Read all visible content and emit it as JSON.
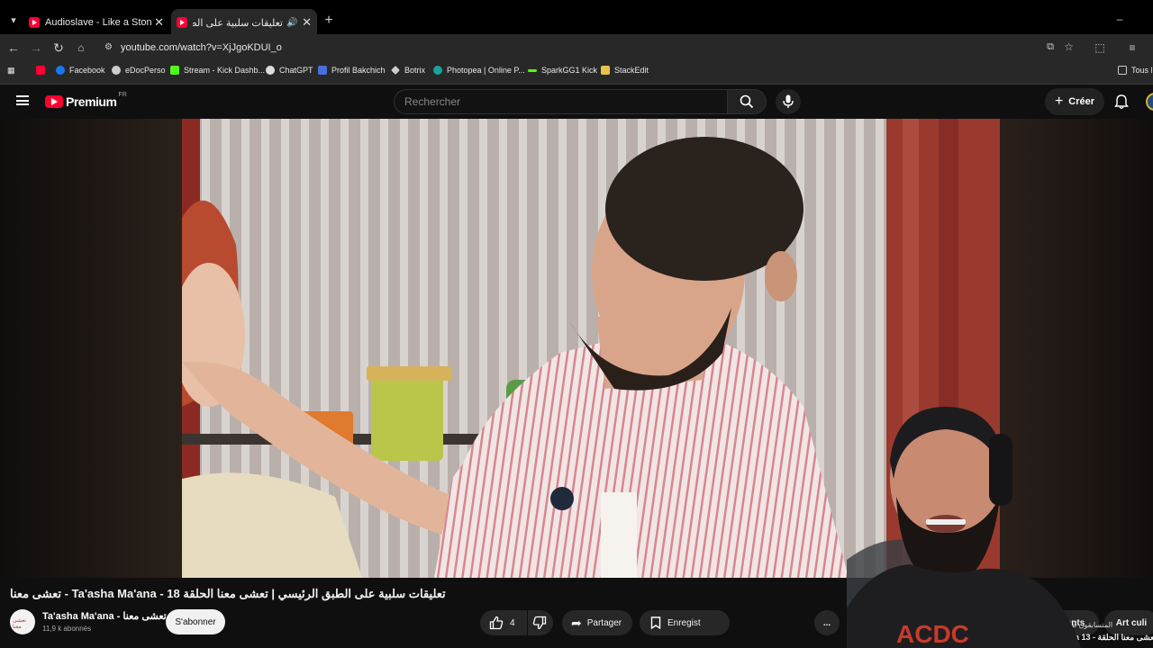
{
  "browser": {
    "tabs": [
      {
        "title": "Audioslave - Like a Stone (Offic",
        "active": false
      },
      {
        "title": "تعليقات سلبية على الطبق الر",
        "active": true
      }
    ],
    "url": "youtube.com/watch?v=XjJgoKDUI_o",
    "bookmarks": [
      "Facebook",
      "eDocPerso",
      "Stream - Kick Dashb...",
      "ChatGPT",
      "Profil Bakchich",
      "Botrix",
      "Photopea | Online P...",
      "SparkGG1 Kick",
      "StackEdit"
    ],
    "bookmarks_overflow": "Tous l"
  },
  "youtube": {
    "logo": "Premium",
    "region": "FR",
    "search_placeholder": "Rechercher",
    "create_label": "Créer"
  },
  "video": {
    "title": "تعشى معنا - Ta'asha Ma'ana - تعليقات سلبية على الطبق الرئيسي | تعشى معنا الحلقة 18",
    "channel_name": "Ta'asha Ma'ana - تعشى معنا",
    "channel_avatar_text": "تعشى معنا",
    "subscribers": "11,9 k abonnés",
    "subscribe_label": "S'abonner",
    "likes": "4",
    "share_label": "Partager",
    "save_label": "Enregist",
    "more_label": "..."
  },
  "side": {
    "chips": [
      "ants",
      "Art culi"
    ],
    "snippet_line1": "المتسابقون صسوية مع",
    "snippet_line2": "aa 13 - تعشى معنا الحلقة"
  }
}
